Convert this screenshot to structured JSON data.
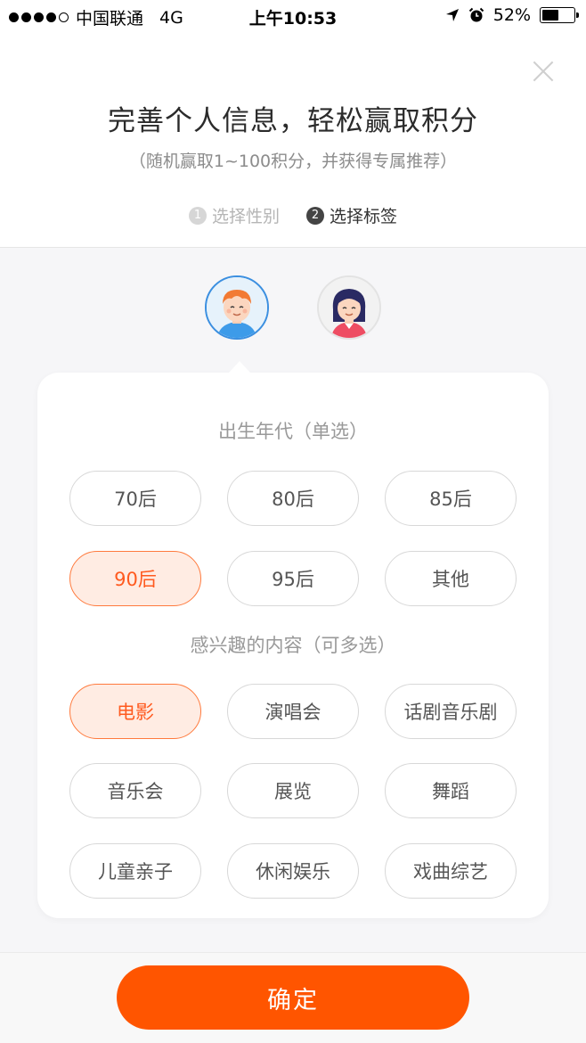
{
  "status_bar": {
    "carrier": "中国联通",
    "network": "4G",
    "time": "上午10:53",
    "battery": "52%",
    "battery_level": 0.52
  },
  "header": {
    "title": "完善个人信息，轻松赢取积分",
    "subtitle": "（随机赢取1~100积分，并获得专属推荐）"
  },
  "steps": [
    {
      "num": "1",
      "label": "选择性别"
    },
    {
      "num": "2",
      "label": "选择标签"
    }
  ],
  "birth_section": {
    "label": "出生年代（单选）",
    "options": [
      "70后",
      "80后",
      "85后",
      "90后",
      "95后",
      "其他"
    ],
    "selected": "90后"
  },
  "interest_section": {
    "label": "感兴趣的内容（可多选）",
    "options": [
      "电影",
      "演唱会",
      "话剧音乐剧",
      "音乐会",
      "展览",
      "舞蹈",
      "儿童亲子",
      "休闲娱乐",
      "戏曲综艺"
    ],
    "selected": [
      "电影"
    ]
  },
  "confirm_label": "确定",
  "colors": {
    "accent": "#ff5500",
    "selected_bg": "#ffece3",
    "selected_border": "#ff7a3d",
    "male_ring": "#3b8fe0"
  },
  "icons": {
    "close": "close-icon",
    "location": "location-arrow-icon",
    "alarm": "alarm-icon",
    "male_avatar": "male-avatar-icon",
    "female_avatar": "female-avatar-icon"
  }
}
